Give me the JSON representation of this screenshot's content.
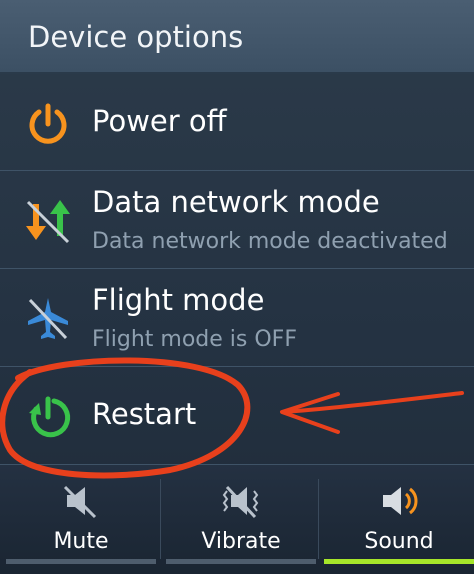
{
  "dialog": {
    "title": "Device options",
    "options": [
      {
        "label": "Power off",
        "icon": "power-icon"
      },
      {
        "label": "Data network mode",
        "sublabel": "Data network mode deactivated",
        "icon": "data-network-icon"
      },
      {
        "label": "Flight mode",
        "sublabel": "Flight mode is OFF",
        "icon": "airplane-icon"
      },
      {
        "label": "Restart",
        "icon": "restart-icon"
      }
    ]
  },
  "sound_modes": [
    {
      "label": "Mute",
      "icon": "mute-icon",
      "selected": false
    },
    {
      "label": "Vibrate",
      "icon": "vibrate-icon",
      "selected": false
    },
    {
      "label": "Sound",
      "icon": "speaker-icon",
      "selected": true
    }
  ],
  "colors": {
    "power_orange": "#f7931e",
    "restart_green": "#39c24a",
    "sound_selected_indicator": "#a6e62a",
    "annotation_red": "#e8401c"
  }
}
